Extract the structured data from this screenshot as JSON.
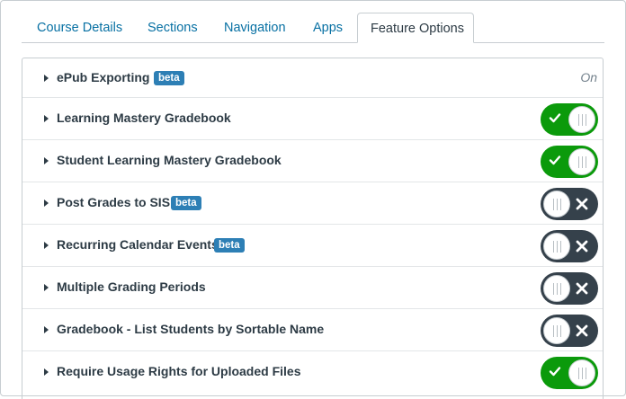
{
  "tabs": [
    {
      "label": "Course Details",
      "active": false
    },
    {
      "label": "Sections",
      "active": false
    },
    {
      "label": "Navigation",
      "active": false
    },
    {
      "label": "Apps",
      "active": false
    },
    {
      "label": "Feature Options",
      "active": true
    }
  ],
  "features": [
    {
      "name": "ePub Exporting",
      "badge": "beta",
      "state_text": "On"
    },
    {
      "name": "Learning Mastery Gradebook",
      "badge": null,
      "enabled": true
    },
    {
      "name": "Student Learning Mastery Gradebook",
      "badge": null,
      "enabled": true
    },
    {
      "name": "Post Grades to SIS",
      "badge": "beta",
      "enabled": false
    },
    {
      "name": "Recurring Calendar Events",
      "badge": "beta",
      "enabled": false
    },
    {
      "name": "Multiple Grading Periods",
      "badge": null,
      "enabled": false
    },
    {
      "name": "Gradebook - List Students by Sortable Name",
      "badge": null,
      "enabled": false
    },
    {
      "name": "Require Usage Rights for Uploaded Files",
      "badge": null,
      "enabled": true
    }
  ],
  "colors": {
    "link": "#0770a3",
    "text": "#2d3b45",
    "toggle_on": "#0b9a0b",
    "toggle_off": "#35414b",
    "badge": "#2d7fb5"
  }
}
